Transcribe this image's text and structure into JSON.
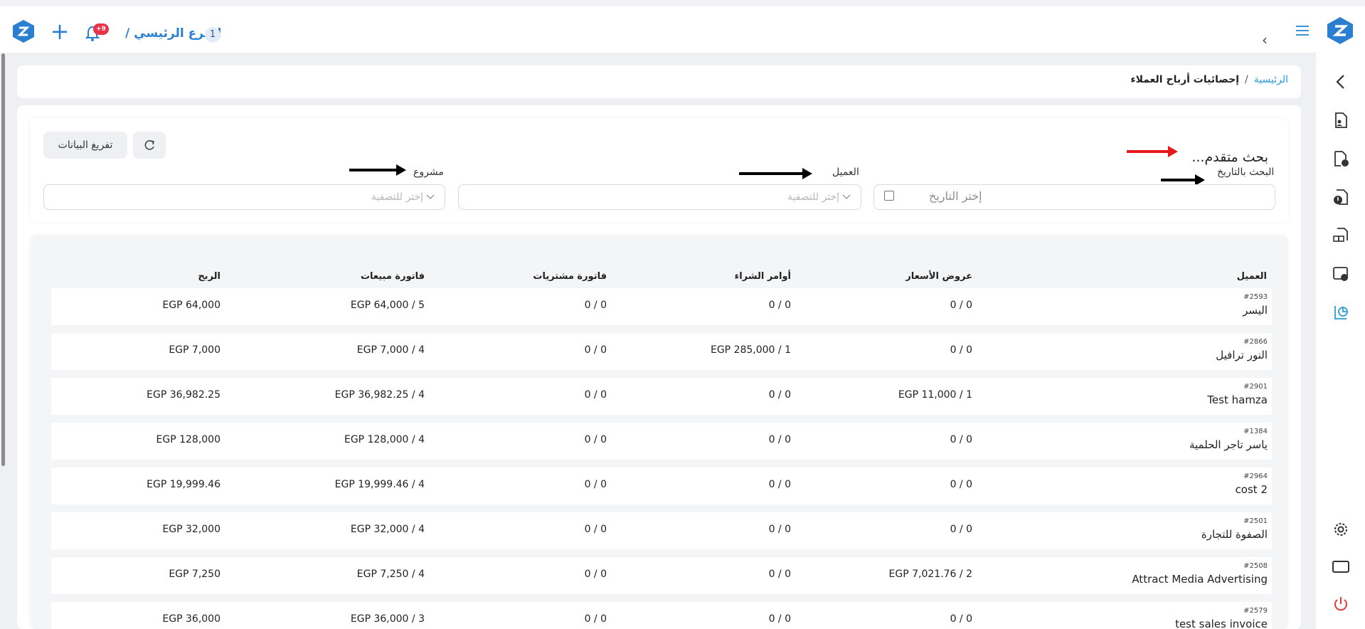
{
  "topbar": {
    "branch_label": "الفرع الرئيسي /",
    "branch_number": "1",
    "notification_badge": "+9",
    "add_icon": "plus-icon",
    "bell_icon": "bell-icon",
    "menu_icon": "hamburger-icon"
  },
  "breadcrumb": {
    "home": "الرئيسية",
    "separator": "/",
    "current": "إحصائيات أرباح العملاء"
  },
  "filters": {
    "advanced_title": "بحث متقدم...",
    "clear_button": "تفريغ البيانات",
    "date_label": "البحث بالتاريخ",
    "date_placeholder": "إختر التاريخ",
    "client_label": "العميل",
    "client_placeholder": "إختر للتصفية",
    "project_label": "مشروع",
    "project_placeholder": "إختر للتصفية"
  },
  "table": {
    "headers": {
      "client": "العميل",
      "quotes": "عروض الأسعار",
      "purchase_orders": "أوامر الشراء",
      "purchase_invoices": "فاتورة مشتريات",
      "sales_invoices": "فاتورة مبيعات",
      "profit": "الربح"
    },
    "rows": [
      {
        "id": "#2593",
        "name": "اليسر",
        "quotes": "0 / 0",
        "po": "0 / 0",
        "pi": "0 / 0",
        "si": "EGP 64,000 / 5",
        "profit": "EGP 64,000"
      },
      {
        "id": "#2866",
        "name": "النور ترافيل",
        "quotes": "0 / 0",
        "po": "EGP 285,000 / 1",
        "pi": "0 / 0",
        "si": "EGP 7,000 / 4",
        "profit": "EGP 7,000"
      },
      {
        "id": "#2901",
        "name": "Test hamza",
        "quotes": "EGP 11,000 / 1",
        "po": "0 / 0",
        "pi": "0 / 0",
        "si": "EGP 36,982.25 / 4",
        "profit": "EGP 36,982.25"
      },
      {
        "id": "#1384",
        "name": "ياسر تاجر الحلمية",
        "quotes": "0 / 0",
        "po": "0 / 0",
        "pi": "0 / 0",
        "si": "EGP 128,000 / 4",
        "profit": "EGP 128,000"
      },
      {
        "id": "#2964",
        "name": "cost 2",
        "quotes": "0 / 0",
        "po": "0 / 0",
        "pi": "0 / 0",
        "si": "EGP 19,999.46 / 4",
        "profit": "EGP 19,999.46"
      },
      {
        "id": "#2501",
        "name": "الصفوة للتجارة",
        "quotes": "0 / 0",
        "po": "0 / 0",
        "pi": "0 / 0",
        "si": "EGP 32,000 / 4",
        "profit": "EGP 32,000"
      },
      {
        "id": "#2508",
        "name": "Attract Media Advertising",
        "quotes": "EGP 7,021.76 / 2",
        "po": "0 / 0",
        "pi": "0 / 0",
        "si": "EGP 7,250 / 4",
        "profit": "EGP 7,250"
      },
      {
        "id": "#2579",
        "name": "test sales invoice",
        "quotes": "0 / 0",
        "po": "0 / 0",
        "pi": "0 / 0",
        "si": "EGP 36,000 / 3",
        "profit": "EGP 36,000"
      }
    ]
  },
  "sidebar_icons": [
    "chevron-left-icon",
    "user-document-icon",
    "document-clock-icon",
    "document-alert-icon",
    "boxes-document-icon",
    "report-settings-icon",
    "chart-report-icon",
    "gear-icon",
    "monitor-icon",
    "power-icon"
  ],
  "colors": {
    "accent": "#2b7fd1",
    "link": "#2b9cd8",
    "badge": "#e8334a",
    "power": "#e23b3b"
  }
}
